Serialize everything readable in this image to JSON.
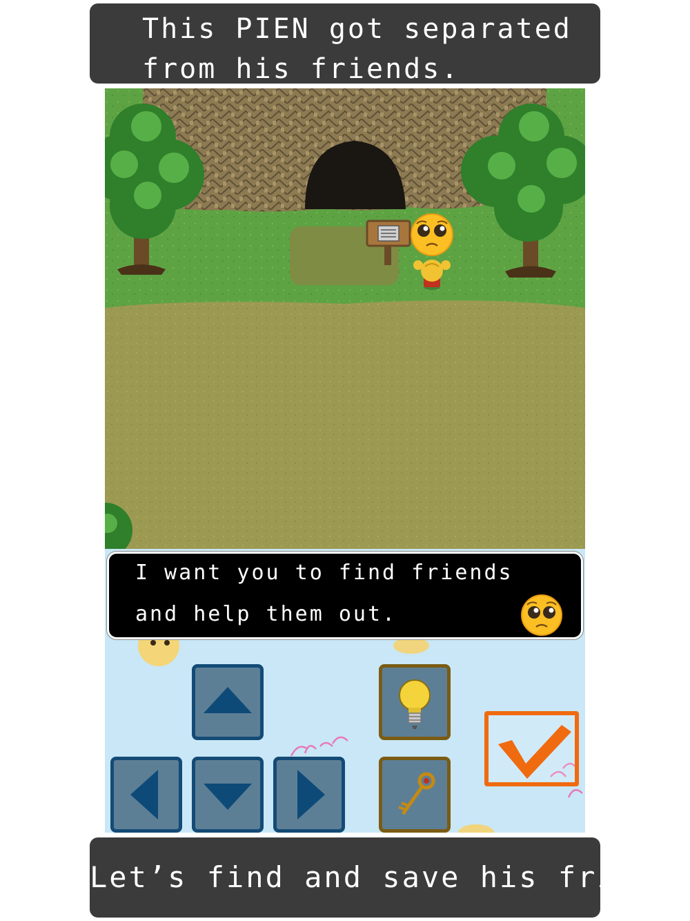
{
  "captions": {
    "top_line1": "This PIEN got separated",
    "top_line2": "from his friends.",
    "bottom": "Let’s find and save his friends."
  },
  "dialog": {
    "line1": "I want you to find friends",
    "line2": "and help them out."
  },
  "controls": {
    "up_icon": "triangle-up",
    "down_icon": "triangle-down",
    "left_icon": "triangle-left",
    "right_icon": "triangle-right",
    "hint_icon": "lightbulb",
    "key_icon": "key",
    "confirm_icon": "checkmark"
  },
  "colors": {
    "caption_bg": "#3b3b3b",
    "dialog_bg": "#000000",
    "control_bg": "#c9e7f6",
    "dpad_border": "#134b76",
    "item_border": "#7a5c14",
    "confirm_accent": "#f06a10"
  }
}
